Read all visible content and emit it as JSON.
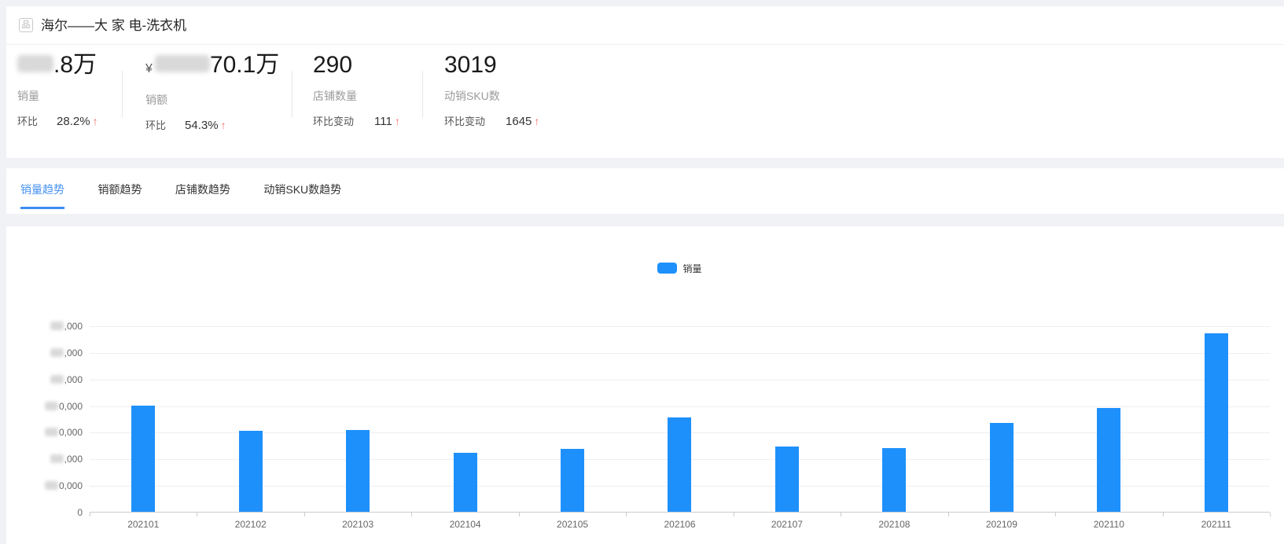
{
  "page": {
    "bg": "#f0f2f5",
    "accent_blue": "#1e90fb",
    "tab_active_blue": "#3d8cf2",
    "up_arrow_red": "#f56c6c",
    "arrow_up": "↑"
  },
  "header": {
    "icon": "brand-grid-icon",
    "icon_glyph": "品",
    "title": "海尔——大 家 电-洗衣机"
  },
  "kpis": [
    {
      "value_prefix": "",
      "value_redacted": true,
      "value_visible": ".8万",
      "label": "销量",
      "delta_label": "环比",
      "delta_value": "28.2%",
      "delta_dir": "up"
    },
    {
      "value_prefix": "¥",
      "value_redacted": true,
      "value_visible": "70.1万",
      "label": "销额",
      "delta_label": "环比",
      "delta_value": "54.3%",
      "delta_dir": "up"
    },
    {
      "value_prefix": "",
      "value_redacted": false,
      "value_visible": "290",
      "label": "店铺数量",
      "delta_label": "环比变动",
      "delta_value": "111",
      "delta_dir": "up"
    },
    {
      "value_prefix": "",
      "value_redacted": false,
      "value_visible": "3019",
      "label": "动销SKU数",
      "delta_label": "环比变动",
      "delta_value": "1645",
      "delta_dir": "up"
    }
  ],
  "tabs": [
    {
      "label": "销量趋势",
      "active": true
    },
    {
      "label": "销额趋势",
      "active": false
    },
    {
      "label": "店铺数趋势",
      "active": false
    },
    {
      "label": "动销SKU数趋势",
      "active": false
    }
  ],
  "chart_data": {
    "type": "bar",
    "title": "",
    "legend": "销量",
    "legend_position": "top-center",
    "categories": [
      "202101",
      "202102",
      "202103",
      "202104",
      "202105",
      "202106",
      "202107",
      "202108",
      "202109",
      "202110",
      "202111"
    ],
    "values": [
      39900,
      30300,
      30700,
      22200,
      23600,
      35600,
      24500,
      23900,
      33300,
      38900,
      67100
    ],
    "xlabel": "",
    "ylabel": "",
    "ylim": [
      0,
      70000
    ],
    "y_tick_step": 10000,
    "grid": true,
    "bar_color": "#1e90fb",
    "y_tick_labels_redacted": true,
    "y_tick_visible_suffixes": [
      ",000",
      ",000",
      ",000",
      "0,000",
      "0,000",
      ",000",
      "0,000",
      "0"
    ]
  }
}
